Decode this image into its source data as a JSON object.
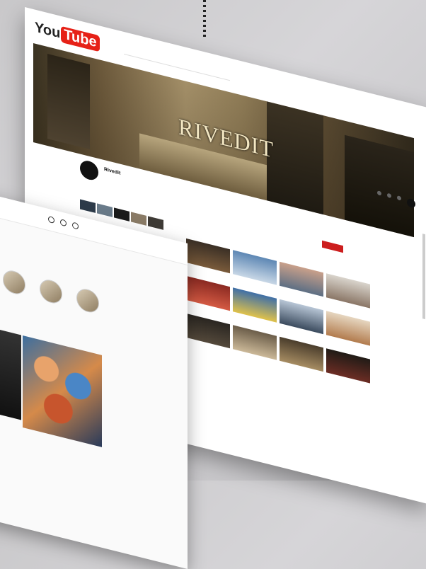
{
  "youtube": {
    "logo_you": "You",
    "logo_tube": "Tube",
    "search_placeholder": "",
    "banner_title": "RIVEDIT",
    "channel_name": "Rivedit",
    "channel_subs": "",
    "tabs": [
      "",
      "",
      "",
      "",
      "",
      ""
    ],
    "subscribe_label": "",
    "videos": [
      {
        "title": "",
        "meta": ""
      },
      {
        "title": "",
        "meta": ""
      },
      {
        "title": "",
        "meta": ""
      },
      {
        "title": "",
        "meta": ""
      },
      {
        "title": "",
        "meta": ""
      },
      {
        "title": "",
        "meta": ""
      },
      {
        "title": "",
        "meta": ""
      },
      {
        "title": "",
        "meta": ""
      },
      {
        "title": "",
        "meta": ""
      },
      {
        "title": "",
        "meta": ""
      },
      {
        "title": "",
        "meta": ""
      },
      {
        "title": "",
        "meta": ""
      }
    ],
    "colors": {
      "brand": "#e62117",
      "subscribe": "#cc1e1e"
    }
  },
  "instagram": {
    "user": "",
    "headline": "",
    "stories_label": "",
    "stories": [
      {
        "label": ""
      },
      {
        "label": ""
      },
      {
        "label": ""
      }
    ],
    "posts_label": ""
  }
}
